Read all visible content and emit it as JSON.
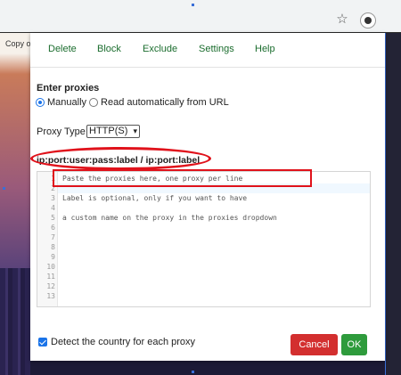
{
  "browser": {
    "star_icon": "star-icon",
    "extension_icon": "proxy-extension-icon"
  },
  "background_page": {
    "copy_text": "Copy o"
  },
  "popup": {
    "tabs": [
      {
        "label": "Delete"
      },
      {
        "label": "Block"
      },
      {
        "label": "Exclude"
      },
      {
        "label": "Settings"
      },
      {
        "label": "Help"
      }
    ],
    "enter_proxies_title": "Enter proxies",
    "mode_manual_label": "Manually",
    "mode_url_label": "Read automatically from URL",
    "mode_selected": "Manually",
    "proxy_type_label": "Proxy Type",
    "proxy_type_value": "HTTP(S)",
    "format_hint": "ip:port:user:pass:label / ip:port:label",
    "editor": {
      "lines": [
        "Paste the proxies here, one proxy per line",
        "",
        "Label is optional, only if you want to have",
        "",
        "a custom name on the proxy in the proxies dropdown",
        "",
        "",
        "",
        "",
        "",
        "",
        "",
        ""
      ],
      "line_numbers": [
        "1",
        "2",
        "3",
        "4",
        "5",
        "6",
        "7",
        "8",
        "9",
        "10",
        "11",
        "12",
        "13"
      ]
    },
    "detect_country_label": "Detect the country for each proxy",
    "detect_country_checked": true,
    "cancel_label": "Cancel",
    "ok_label": "OK"
  },
  "colors": {
    "tab_text": "#1b6d2e",
    "cancel": "#d32f2f",
    "ok": "#2e9b3c",
    "annotation": "#e0121b",
    "accent": "#1a73e8"
  }
}
